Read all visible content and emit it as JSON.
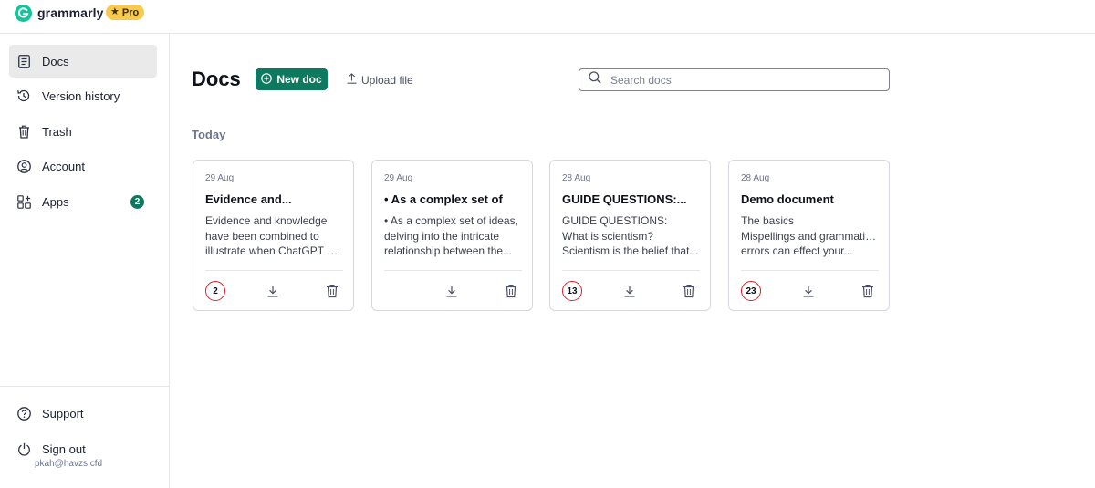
{
  "app": {
    "brand": "grammarly",
    "badge": "Pro"
  },
  "sidebar": {
    "items": [
      {
        "label": "Docs",
        "icon": "document-icon",
        "active": true
      },
      {
        "label": "Version history",
        "icon": "history-icon"
      },
      {
        "label": "Trash",
        "icon": "trash-icon"
      },
      {
        "label": "Account",
        "icon": "account-icon"
      },
      {
        "label": "Apps",
        "icon": "apps-icon",
        "badge": "2"
      }
    ],
    "bottom": [
      {
        "label": "Support",
        "icon": "help-icon"
      },
      {
        "label": "Sign out",
        "icon": "power-icon"
      }
    ],
    "user_email": "pkah@havzs.cfd"
  },
  "main": {
    "title": "Docs",
    "new_doc_label": "New doc",
    "upload_label": "Upload file",
    "search_placeholder": "Search docs",
    "section_label": "Today",
    "cards": [
      {
        "date": "29 Aug",
        "title": "Evidence and...",
        "preview": [
          "Evidence and knowledge",
          "have been combined to",
          "illustrate when ChatGPT ca..."
        ],
        "score": "2"
      },
      {
        "date": "29 Aug",
        "title": "• As a complex set of",
        "preview": [
          "• As a complex set of ideas,",
          "delving into the intricate",
          "relationship between the..."
        ],
        "score": ""
      },
      {
        "date": "28 Aug",
        "title": "GUIDE QUESTIONS:...",
        "preview": [
          "GUIDE QUESTIONS:",
          "What is scientism?",
          "Scientism is the belief that..."
        ],
        "score": "13"
      },
      {
        "date": "28 Aug",
        "title": "Demo document",
        "preview": [
          "The basics",
          "Mispellings and grammatical",
          "errors can effect your..."
        ],
        "score": "23"
      }
    ]
  },
  "colors": {
    "accent": "#0d7a5f",
    "score_ring": "#d6212a",
    "pro_badge": "#f7c94d",
    "logo": "#15c39a"
  }
}
